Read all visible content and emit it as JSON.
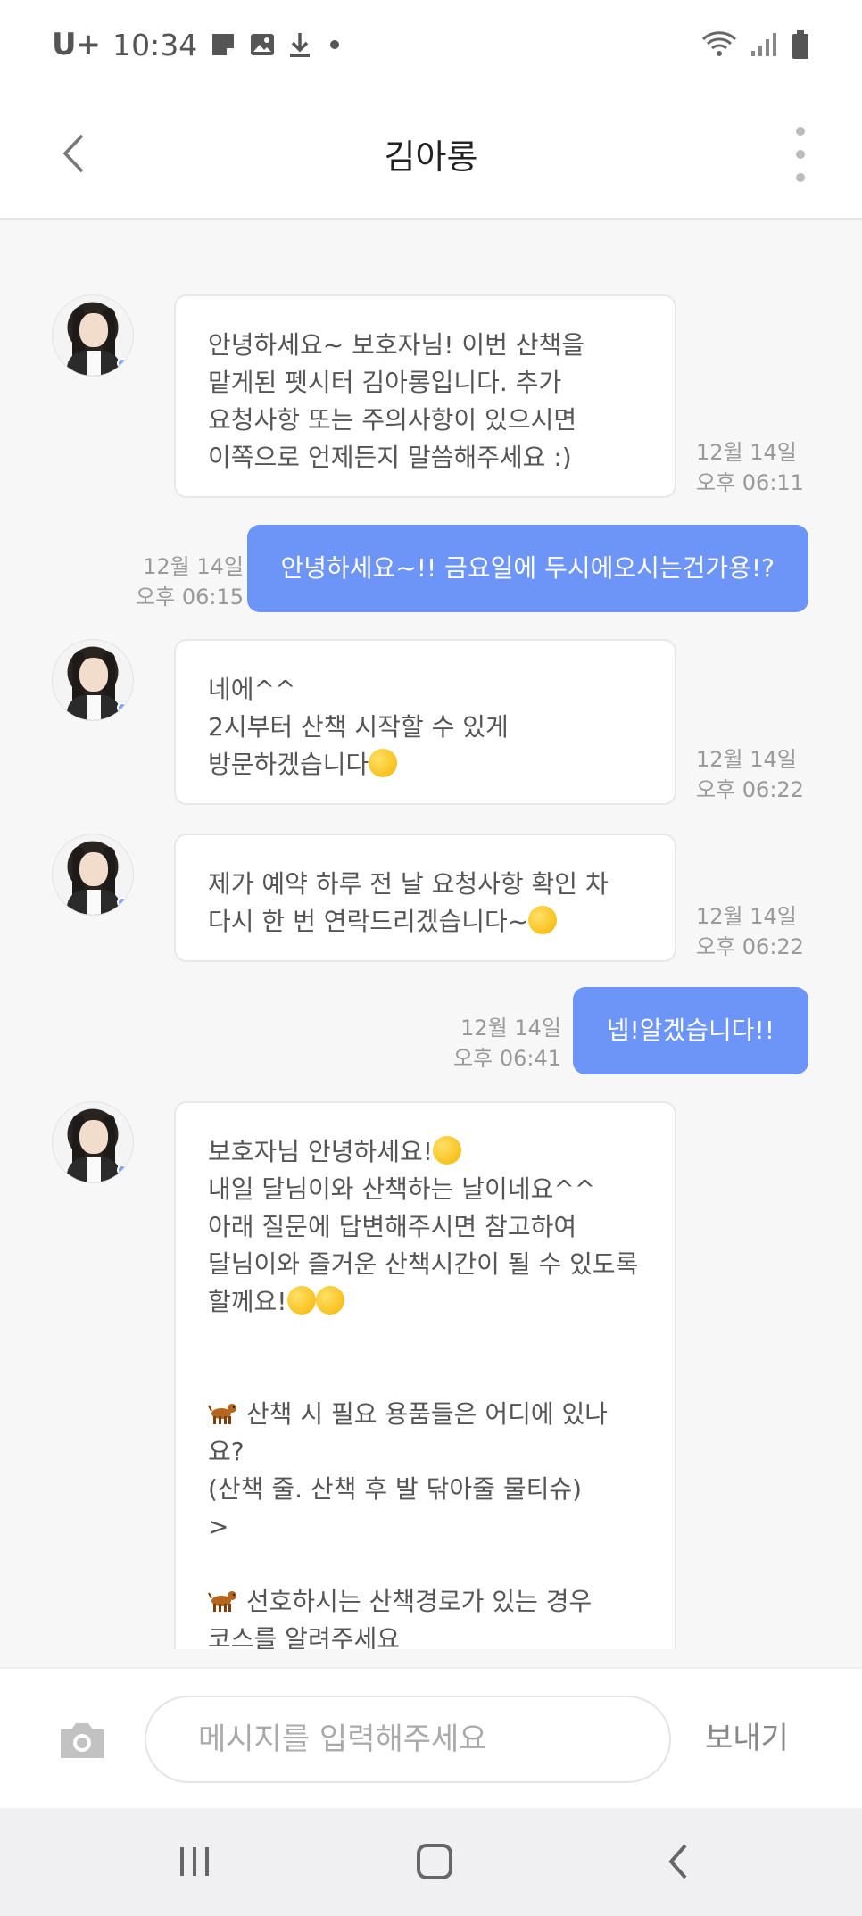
{
  "status_bar": {
    "carrier": "U+",
    "time": "10:34"
  },
  "header": {
    "title": "김아롱"
  },
  "messages": [
    {
      "side": "in",
      "text": "안녕하세요~ 보호자님! 이번 산책을\n맡게된 펫시터 김아롱입니다. 추가\n요청사항 또는 주의사항이 있으시면\n이쪽으로 언제든지 말씀해주세요 :)",
      "date": "12월 14일",
      "time": "오후 06:11"
    },
    {
      "side": "out",
      "text": "안녕하세요~!! 금요일에 두시에오시는건가용!?",
      "date": "12월 14일",
      "time": "오후 06:15"
    },
    {
      "side": "in",
      "text_line1": "네에^^",
      "text_line2": "2시부터 산책 시작할 수 있게",
      "text_line3": "방문하겠습니다",
      "date": "12월 14일",
      "time": "오후 06:22"
    },
    {
      "side": "in",
      "text_line1": "제가 예약 하루 전 날 요청사항 확인 차",
      "text_line2": "다시 한 번 연락드리겠습니다~",
      "date": "12월 14일",
      "time": "오후 06:22"
    },
    {
      "side": "out",
      "text": "넵!알겠습니다!!",
      "date": "12월 14일",
      "time": "오후 06:41"
    },
    {
      "side": "in",
      "line1": "보호자님 안녕하세요!",
      "line2": "내일 달님이와 산책하는 날이네요^^",
      "line3": "아래 질문에 답변해주시면 참고하여",
      "line4": "달님이와 즐거운 산책시간이 될 수 있도록",
      "line5": "할께요!",
      "q1_line1": " 산책 시 필요 용품들은 어디에 있나요?",
      "q1_line2": "(산책 줄. 산책 후 발 닦아줄 물티슈)",
      "q1_answer": ">",
      "q2_line1": " 선호하시는 산책경로가 있는 경우",
      "q2_line2": "코스를 알려주세요",
      "q2_answer": ">"
    }
  ],
  "input_bar": {
    "placeholder": "메시지를 입력해주세요",
    "send_label": "보내기"
  },
  "colors": {
    "outgoing_bubble": "#6c95f7",
    "background": "#f7f7f8"
  }
}
